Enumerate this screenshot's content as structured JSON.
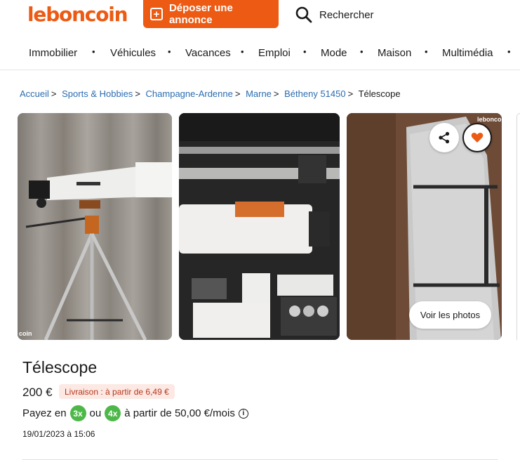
{
  "header": {
    "logo": "leboncoin",
    "deposit_label": "Déposer une annonce",
    "search_label": "Rechercher"
  },
  "categories": [
    "Immobilier",
    "Véhicules",
    "Vacances",
    "Emploi",
    "Mode",
    "Maison",
    "Multimédia"
  ],
  "breadcrumb": {
    "items": [
      "Accueil",
      "Sports & Hobbies",
      "Champagne-Ardenne",
      "Marne",
      "Bétheny 51450"
    ],
    "current": "Télescope"
  },
  "gallery": {
    "see_photos_label": "Voir les photos",
    "watermark_left": "coin",
    "watermark_right": "leboncoin"
  },
  "listing": {
    "title": "Télescope",
    "price": "200 €",
    "delivery": "Livraison : à partir de 6,49 €",
    "pay_prefix": "Payez en",
    "pay_badge_1": "3x",
    "pay_or": "ou",
    "pay_badge_2": "4x",
    "pay_suffix": "à partir de 50,00 €/mois",
    "date": "19/01/2023 à 15:06"
  },
  "colors": {
    "brand": "#ec5a13",
    "link": "#2b6cb0",
    "pay_badge": "#4db848",
    "delivery_bg": "#fde9e4"
  }
}
